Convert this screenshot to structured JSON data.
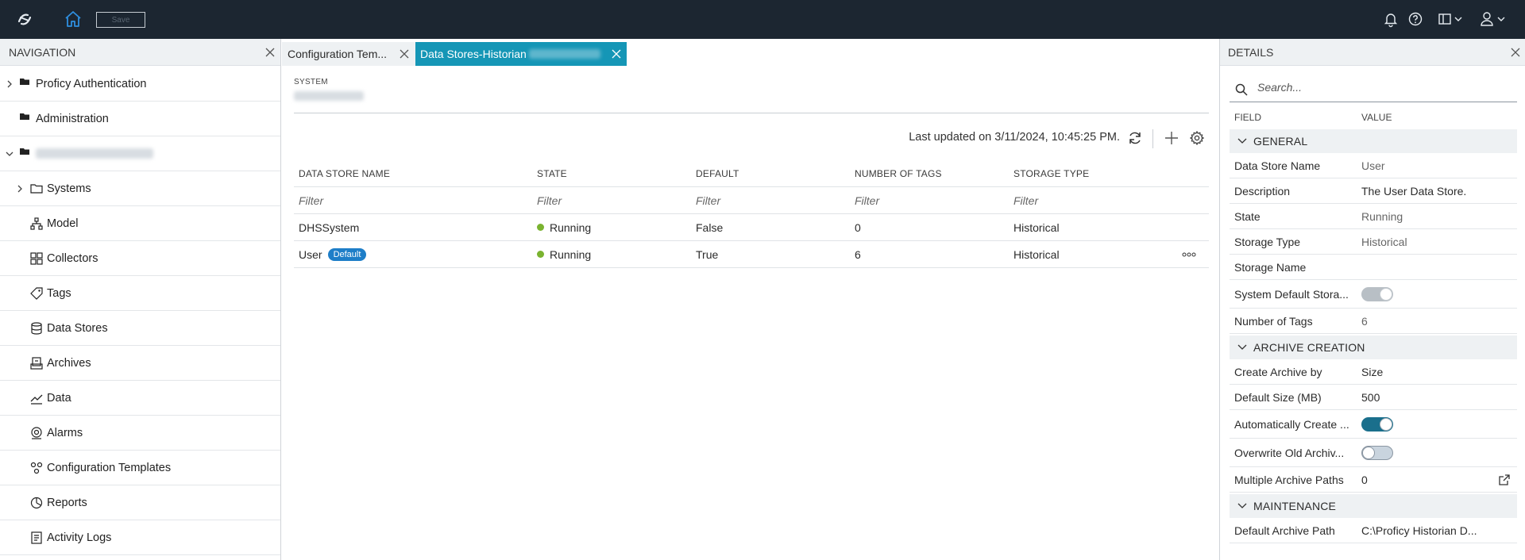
{
  "topbar": {
    "save_label": "Save"
  },
  "navigation": {
    "title": "NAVIGATION",
    "items": [
      {
        "label": "Proficy Authentication",
        "icon": "folder-filled-icon",
        "expandable": true
      },
      {
        "label": "Administration",
        "icon": "folder-filled-icon",
        "expandable": false
      },
      {
        "label": "",
        "icon": "folder-open-icon",
        "expandable": true
      },
      {
        "label": "Systems",
        "icon": "folder-outline-icon",
        "expandable": true
      },
      {
        "label": "Model",
        "icon": "model-hierarchy-icon",
        "expandable": false
      },
      {
        "label": "Collectors",
        "icon": "collectors-grid-icon",
        "expandable": false
      },
      {
        "label": "Tags",
        "icon": "tag-icon",
        "expandable": false
      },
      {
        "label": "Data Stores",
        "icon": "database-icon",
        "expandable": false
      },
      {
        "label": "Archives",
        "icon": "archives-icon",
        "expandable": false
      },
      {
        "label": "Data",
        "icon": "line-chart-icon",
        "expandable": false
      },
      {
        "label": "Alarms",
        "icon": "alarm-icon",
        "expandable": false
      },
      {
        "label": "Configuration Templates",
        "icon": "templates-icon",
        "expandable": false
      },
      {
        "label": "Reports",
        "icon": "reports-icon",
        "expandable": false
      },
      {
        "label": "Activity Logs",
        "icon": "activity-log-icon",
        "expandable": false
      }
    ]
  },
  "tabs": [
    {
      "label": "Configuration Tem...",
      "active": false
    },
    {
      "label": "Data Stores-Historian",
      "active": true
    }
  ],
  "center": {
    "system_label": "SYSTEM",
    "last_updated": "Last updated on 3/11/2024, 10:45:25 PM.",
    "columns": [
      "DATA STORE NAME",
      "STATE",
      "DEFAULT",
      "NUMBER OF TAGS",
      "STORAGE TYPE"
    ],
    "filter_placeholder": "Filter",
    "rows": [
      {
        "name": "DHSSystem",
        "badge": "",
        "state": "Running",
        "default": "False",
        "tags": "0",
        "storage": "Historical"
      },
      {
        "name": "User",
        "badge": "Default",
        "state": "Running",
        "default": "True",
        "tags": "6",
        "storage": "Historical"
      }
    ]
  },
  "details": {
    "title": "DETAILS",
    "search_placeholder": "Search...",
    "field_header": "FIELD",
    "value_header": "VALUE",
    "sections": {
      "general": "GENERAL",
      "archive": "ARCHIVE CREATION",
      "maintenance": "MAINTENANCE"
    },
    "fields": {
      "data_store_name": {
        "label": "Data Store Name",
        "value": "User"
      },
      "description": {
        "label": "Description",
        "value": "The User Data Store."
      },
      "state": {
        "label": "State",
        "value": "Running"
      },
      "storage_type": {
        "label": "Storage Type",
        "value": "Historical"
      },
      "storage_name": {
        "label": "Storage Name",
        "value": ""
      },
      "system_default": {
        "label": "System Default Stora...",
        "value": true
      },
      "number_of_tags": {
        "label": "Number of Tags",
        "value": "6"
      },
      "create_archive_by": {
        "label": "Create Archive by",
        "value": "Size"
      },
      "default_size": {
        "label": "Default Size (MB)",
        "value": "500"
      },
      "auto_create": {
        "label": "Automatically Create ...",
        "value": true
      },
      "overwrite_old": {
        "label": "Overwrite Old Archiv...",
        "value": false
      },
      "multiple_paths": {
        "label": "Multiple Archive Paths",
        "value": "0"
      },
      "default_archive_path": {
        "label": "Default Archive Path",
        "value": "C:\\Proficy Historian D..."
      }
    }
  },
  "colors": {
    "topbar": "#1c2631",
    "active_tab": "#1596b6",
    "running": "#7ab330",
    "badge": "#1e7ec8",
    "toggle_on": "#1a6f8c"
  }
}
